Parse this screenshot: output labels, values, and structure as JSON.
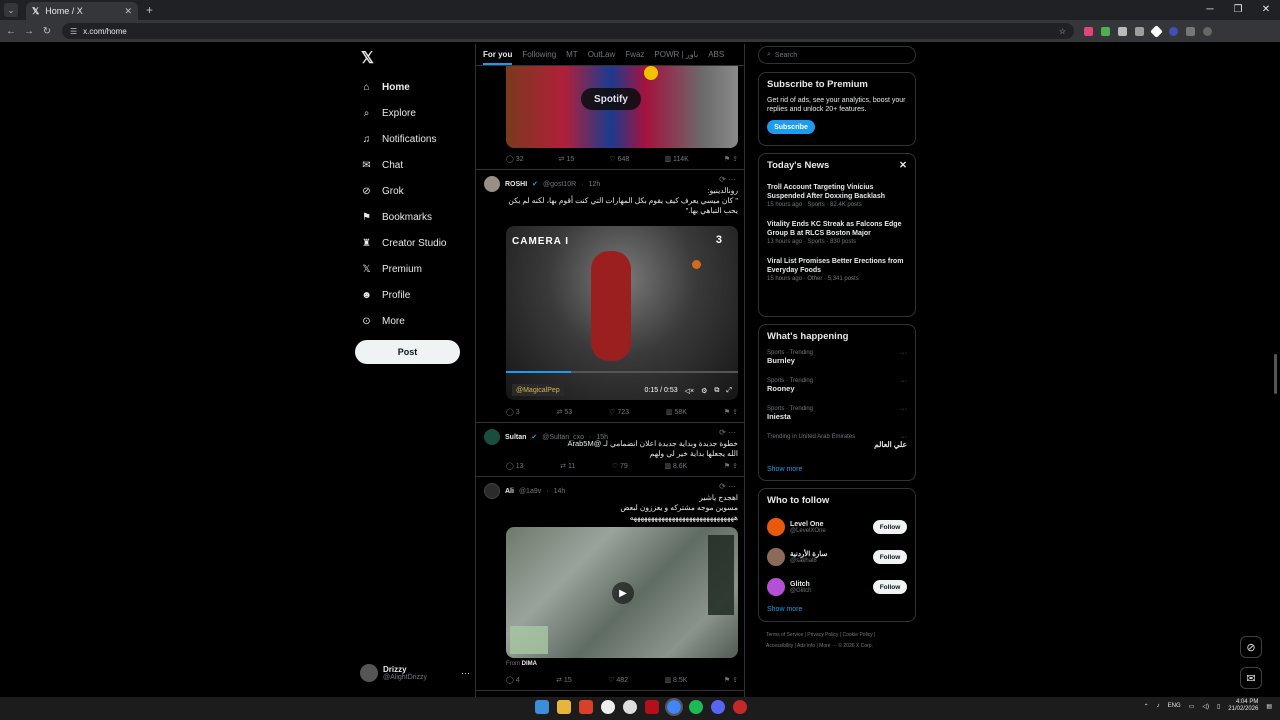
{
  "browser": {
    "tab_title": "Home / X",
    "url": "x.com/home",
    "newtab": "+",
    "min": "─",
    "max": "❐",
    "close": "✕"
  },
  "nav": {
    "logo": "𝕏",
    "items": [
      {
        "label": "Home",
        "icon": "home-icon",
        "glyph": "⌂"
      },
      {
        "label": "Explore",
        "icon": "search-icon",
        "glyph": "⌕"
      },
      {
        "label": "Notifications",
        "icon": "bell-icon",
        "glyph": "♫"
      },
      {
        "label": "Chat",
        "icon": "mail-icon",
        "glyph": "✉"
      },
      {
        "label": "Grok",
        "icon": "grok-icon",
        "glyph": "⊘"
      },
      {
        "label": "Bookmarks",
        "icon": "bookmark-icon",
        "glyph": "⚑"
      },
      {
        "label": "Creator Studio",
        "icon": "creator-icon",
        "glyph": "♜"
      },
      {
        "label": "Premium",
        "icon": "x-icon",
        "glyph": "𝕏"
      },
      {
        "label": "Profile",
        "icon": "person-icon",
        "glyph": "☻"
      },
      {
        "label": "More",
        "icon": "more-icon",
        "glyph": "⊙"
      }
    ],
    "post_label": "Post",
    "me_name": "Drizzy",
    "me_handle": "@AlightDrizzy"
  },
  "feed": {
    "tabs": [
      "For you",
      "Following",
      "MT",
      "OutLaw",
      "Fwaz",
      "POWR | باور",
      "ABS"
    ],
    "post0": {
      "replies": "32",
      "reposts": "15",
      "likes": "648",
      "views": "114K"
    },
    "post1": {
      "name": "ROSHI",
      "handle": "@gost10R",
      "time": "12h",
      "line1": "رونالدينيو:",
      "line2": "\" كان ميسي يعرف كيف يقوم بكل المهارات التي كنت أقوم بها، لكنه لم يكن يحب التباهي بها.\"",
      "overlay_cam": "CAMERA I",
      "overlay_num": "3",
      "credit": "@MagicalPep",
      "duration": "0:15 / 0:53",
      "replies": "3",
      "reposts": "53",
      "likes": "723",
      "views": "58K"
    },
    "post2": {
      "name": "Sultan",
      "handle": "@Sultan_cxo",
      "time": "15h",
      "line1": "خطوة جديدة وبداية جديدة  اعلان انضمامي لـ @Arab5M",
      "line2": "الله يجعلها بداية خير لي ولهم",
      "replies": "13",
      "reposts": "11",
      "likes": "79",
      "views": "8.6K"
    },
    "post3": {
      "name": "Ali",
      "handle": "@1a9v",
      "time": "14h",
      "line1": "اهجدج ياشير",
      "line2": "مسوين موجه مشتركه و يعززون لبعض",
      "line3": "ههههههههههههههههههههههههههههههه",
      "from_label": "From",
      "from_name": "DIMA",
      "replies": "4",
      "reposts": "15",
      "likes": "482",
      "views": "8.5K"
    }
  },
  "right": {
    "search_placeholder": "Search",
    "premium_title": "Subscribe to Premium",
    "premium_text": "Get rid of ads, see your analytics, boost your replies and unlock 20+ features.",
    "subscribe_label": "Subscribe",
    "news_title": "Today's News",
    "news": [
      {
        "title": "Troll Account Targeting Vinícius Suspended After Doxxing Backlash",
        "meta": "15 hours ago · Sports · 82.4K posts"
      },
      {
        "title": "Vitality Ends KC Streak as Falcons Edge Group B at RLCS Boston Major",
        "meta": "13 hours ago · Sports · 830 posts"
      },
      {
        "title": "Viral List Promises Better Erections from Everyday Foods",
        "meta": "15 hours ago · Other · 5,341 posts"
      }
    ],
    "happening_title": "What's happening",
    "trends": [
      {
        "cat": "Sports · Trending",
        "name": "Burnley"
      },
      {
        "cat": "Sports · Trending",
        "name": "Rooney"
      },
      {
        "cat": "Sports · Trending",
        "name": "Iniesta"
      },
      {
        "cat": "Trending in United Arab Emirates",
        "name": "علي العالم"
      }
    ],
    "show_more": "Show more",
    "wtf_title": "Who to follow",
    "follow": [
      {
        "name": "Level One",
        "handle": "@LevelXOne",
        "color": "#e8590c"
      },
      {
        "name": "سارة الأردنية",
        "handle": "@sakhal8",
        "color": "#8a6a5a"
      },
      {
        "name": "Glitch",
        "handle": "@Glitch",
        "color": "#b44fd6"
      }
    ],
    "follow_label": "Follow",
    "footer1": "Terms of Service  |  Privacy Policy  |  Cookie Policy  |",
    "footer2": "Accessibility  |  Ads info  |  More ···  © 2026 X Corp."
  },
  "taskbar": {
    "lang": "ENG",
    "time": "4:04 PM",
    "date": "21/02/2026"
  }
}
